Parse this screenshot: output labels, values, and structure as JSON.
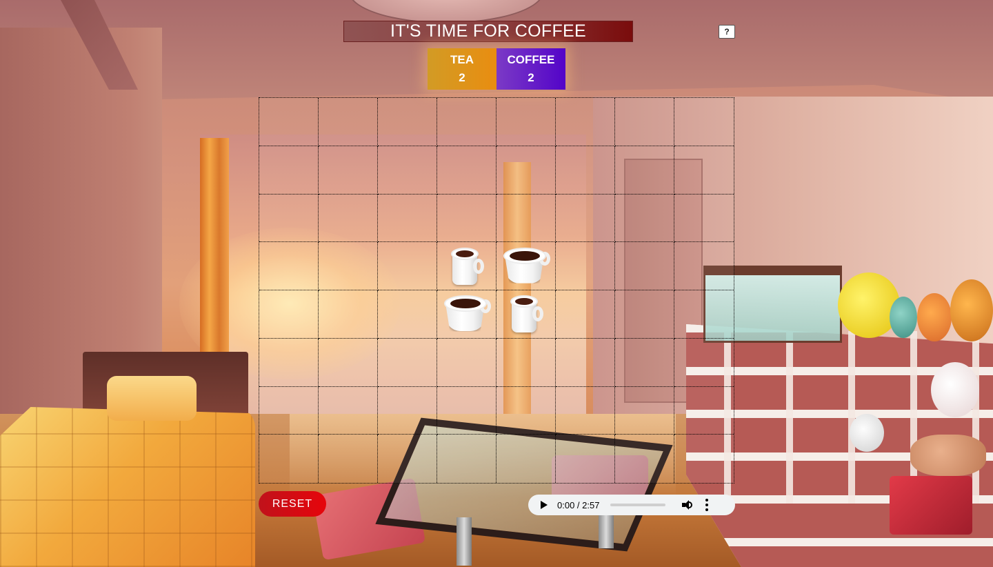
{
  "game": {
    "title": "IT'S TIME FOR COFFEE",
    "help_label": "?",
    "reset_label": "RESET"
  },
  "score": {
    "tea": {
      "label": "TEA",
      "value": "2",
      "color": "#e98d10"
    },
    "coffee": {
      "label": "COFFEE",
      "value": "2",
      "color": "#5304c8"
    }
  },
  "board": {
    "rows": 8,
    "cols": 8,
    "pieces": [
      {
        "row": 3,
        "col": 3,
        "type": "tea"
      },
      {
        "row": 3,
        "col": 4,
        "type": "coffee"
      },
      {
        "row": 4,
        "col": 3,
        "type": "coffee"
      },
      {
        "row": 4,
        "col": 4,
        "type": "tea"
      }
    ]
  },
  "audio": {
    "time": "0:00 / 2:57",
    "progress": 0
  }
}
